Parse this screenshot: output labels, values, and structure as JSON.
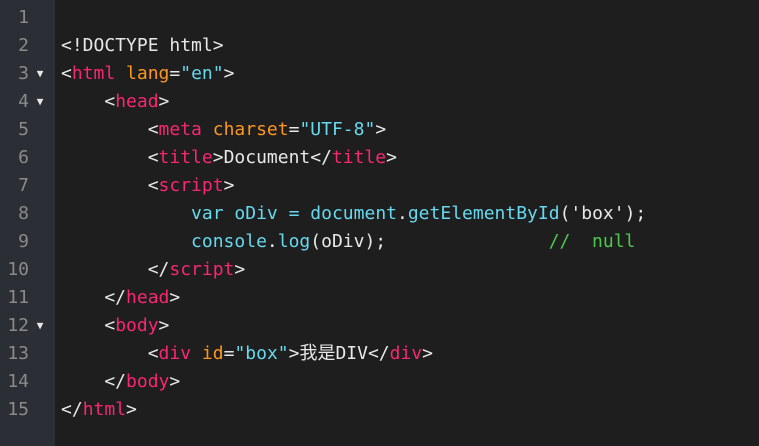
{
  "editor": {
    "lines": [
      {
        "num": "1",
        "fold": "",
        "tokens": []
      },
      {
        "num": "2",
        "fold": "",
        "tokens": [
          {
            "t": "<!DOCTYPE html>",
            "c": "br"
          }
        ]
      },
      {
        "num": "3",
        "fold": "▼",
        "tokens": [
          {
            "t": "<",
            "c": "br"
          },
          {
            "t": "html",
            "c": "tag"
          },
          {
            "t": " ",
            "c": "br"
          },
          {
            "t": "lang",
            "c": "attr"
          },
          {
            "t": "=",
            "c": "br"
          },
          {
            "t": "\"en\"",
            "c": "str"
          },
          {
            "t": ">",
            "c": "br"
          }
        ]
      },
      {
        "num": "4",
        "fold": "▼",
        "tokens": [
          {
            "t": "    <",
            "c": "br"
          },
          {
            "t": "head",
            "c": "tag"
          },
          {
            "t": ">",
            "c": "br"
          }
        ]
      },
      {
        "num": "5",
        "fold": "",
        "tokens": [
          {
            "t": "        <",
            "c": "br"
          },
          {
            "t": "meta",
            "c": "tag"
          },
          {
            "t": " ",
            "c": "br"
          },
          {
            "t": "charset",
            "c": "attr"
          },
          {
            "t": "=",
            "c": "br"
          },
          {
            "t": "\"UTF-8\"",
            "c": "str"
          },
          {
            "t": ">",
            "c": "br"
          }
        ]
      },
      {
        "num": "6",
        "fold": "",
        "tokens": [
          {
            "t": "        <",
            "c": "br"
          },
          {
            "t": "title",
            "c": "tag"
          },
          {
            "t": ">Document</",
            "c": "br"
          },
          {
            "t": "title",
            "c": "tag"
          },
          {
            "t": ">",
            "c": "br"
          }
        ]
      },
      {
        "num": "7",
        "fold": "",
        "tokens": [
          {
            "t": "        <",
            "c": "br"
          },
          {
            "t": "script",
            "c": "tag"
          },
          {
            "t": ">",
            "c": "br"
          }
        ]
      },
      {
        "num": "8",
        "fold": "",
        "tokens": [
          {
            "t": "            ",
            "c": "br"
          },
          {
            "t": "var",
            "c": "kw"
          },
          {
            "t": " ",
            "c": "br"
          },
          {
            "t": "oDiv",
            "c": "str"
          },
          {
            "t": " ",
            "c": "br"
          },
          {
            "t": "=",
            "c": "kw"
          },
          {
            "t": " ",
            "c": "br"
          },
          {
            "t": "document",
            "c": "kw"
          },
          {
            "t": ".",
            "c": "br"
          },
          {
            "t": "getElementById",
            "c": "str"
          },
          {
            "t": "('box');",
            "c": "br"
          }
        ]
      },
      {
        "num": "9",
        "fold": "",
        "tokens": [
          {
            "t": "            ",
            "c": "br"
          },
          {
            "t": "console",
            "c": "kw"
          },
          {
            "t": ".",
            "c": "br"
          },
          {
            "t": "log",
            "c": "str"
          },
          {
            "t": "(oDiv);",
            "c": "br"
          },
          {
            "t": "               ",
            "c": "br"
          },
          {
            "t": "//  null",
            "c": "cm"
          }
        ]
      },
      {
        "num": "10",
        "fold": "",
        "tokens": [
          {
            "t": "        </",
            "c": "br"
          },
          {
            "t": "script",
            "c": "tag"
          },
          {
            "t": ">",
            "c": "br"
          }
        ]
      },
      {
        "num": "11",
        "fold": "",
        "tokens": [
          {
            "t": "    </",
            "c": "br"
          },
          {
            "t": "head",
            "c": "tag"
          },
          {
            "t": ">",
            "c": "br"
          }
        ]
      },
      {
        "num": "12",
        "fold": "▼",
        "tokens": [
          {
            "t": "    <",
            "c": "br"
          },
          {
            "t": "body",
            "c": "tag"
          },
          {
            "t": ">",
            "c": "br"
          }
        ]
      },
      {
        "num": "13",
        "fold": "",
        "tokens": [
          {
            "t": "        <",
            "c": "br"
          },
          {
            "t": "div",
            "c": "tag"
          },
          {
            "t": " ",
            "c": "br"
          },
          {
            "t": "id",
            "c": "attr"
          },
          {
            "t": "=",
            "c": "br"
          },
          {
            "t": "\"box\"",
            "c": "str"
          },
          {
            "t": ">我是DIV</",
            "c": "br"
          },
          {
            "t": "div",
            "c": "tag"
          },
          {
            "t": ">",
            "c": "br"
          }
        ]
      },
      {
        "num": "14",
        "fold": "",
        "tokens": [
          {
            "t": "    </",
            "c": "br"
          },
          {
            "t": "body",
            "c": "tag"
          },
          {
            "t": ">",
            "c": "br"
          }
        ]
      },
      {
        "num": "15",
        "fold": "",
        "tokens": [
          {
            "t": "</",
            "c": "br"
          },
          {
            "t": "html",
            "c": "tag"
          },
          {
            "t": ">",
            "c": "br"
          }
        ]
      }
    ]
  }
}
